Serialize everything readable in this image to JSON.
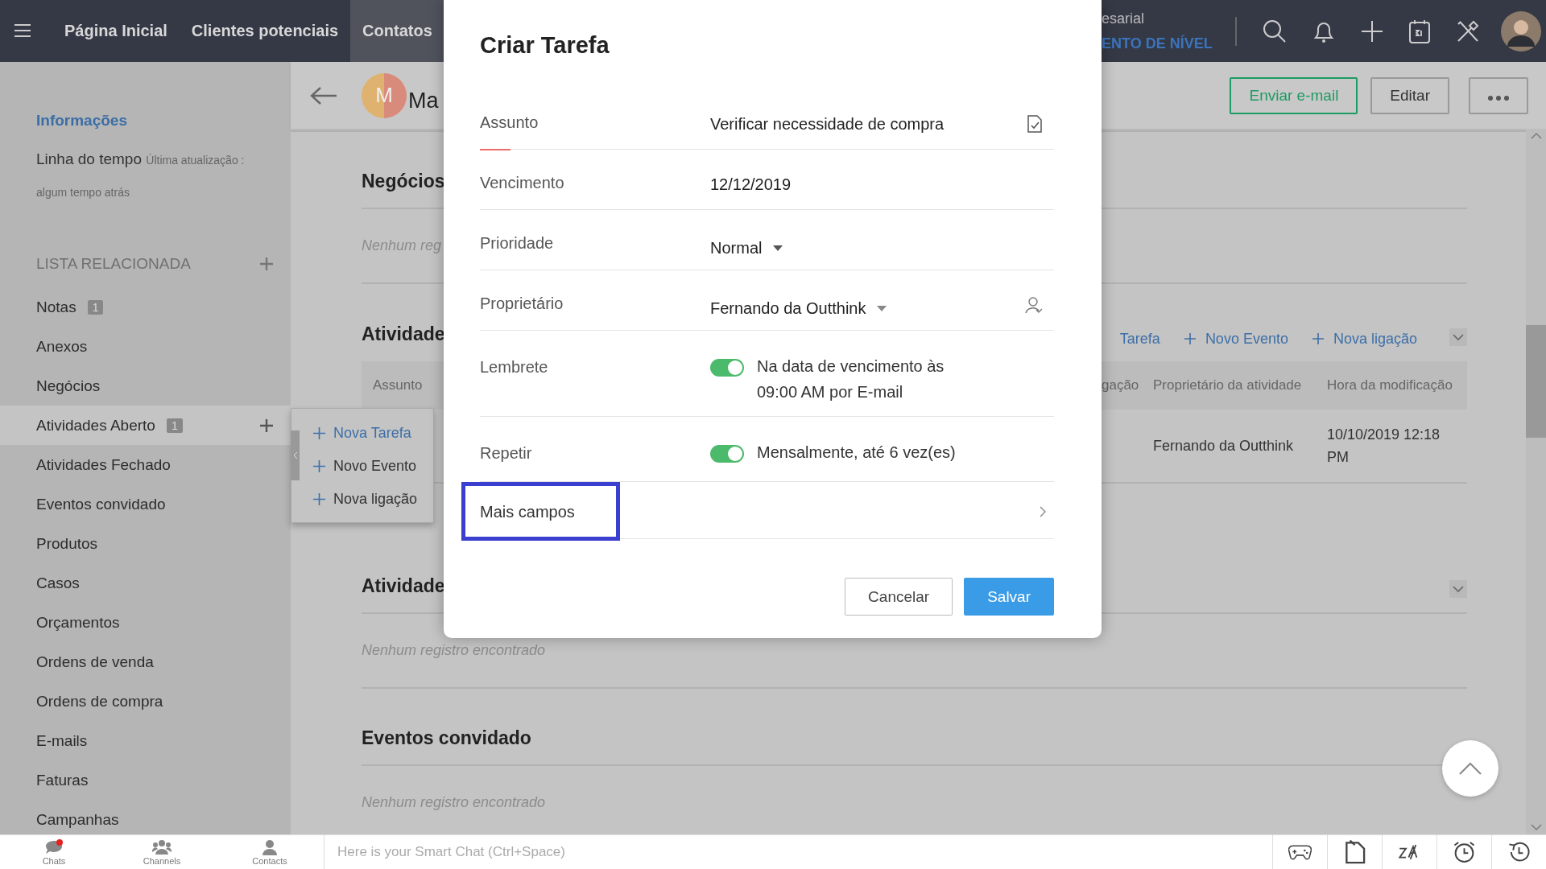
{
  "top_nav": {
    "items": [
      {
        "label": "Página Inicial",
        "selected": false
      },
      {
        "label": "Clientes potenciais",
        "selected": false
      },
      {
        "label": "Contatos",
        "selected": true
      }
    ],
    "edition_text": "esarial",
    "upgrade_link": "ENTO DE NÍVEL"
  },
  "sidebar": {
    "info_link": "Informações",
    "timeline_label": "Linha do tempo",
    "timeline_updated": "Última atualização :",
    "timeline_time": "algum tempo atrás",
    "related_heading": "LISTA RELACIONADA",
    "items": [
      {
        "label": "Notas",
        "badge": "1",
        "selected": false
      },
      {
        "label": "Anexos",
        "selected": false
      },
      {
        "label": "Negócios",
        "selected": false
      },
      {
        "label": "Atividades Aberto",
        "badge": "1",
        "selected": true
      },
      {
        "label": "Atividades Fechado",
        "selected": false
      },
      {
        "label": "Eventos convidado",
        "selected": false
      },
      {
        "label": "Produtos",
        "selected": false
      },
      {
        "label": "Casos",
        "selected": false
      },
      {
        "label": "Orçamentos",
        "selected": false
      },
      {
        "label": "Ordens de venda",
        "selected": false
      },
      {
        "label": "Ordens de compra",
        "selected": false
      },
      {
        "label": "E-mails",
        "selected": false
      },
      {
        "label": "Faturas",
        "selected": false
      },
      {
        "label": "Campanhas",
        "selected": false
      }
    ]
  },
  "popover": {
    "items": [
      {
        "label": "Nova Tarefa",
        "selected": true
      },
      {
        "label": "Novo Evento",
        "selected": false
      },
      {
        "label": "Nova ligação",
        "selected": false
      }
    ]
  },
  "record": {
    "avatar_letter": "M",
    "name": "Ma",
    "actions": [
      {
        "label": "Enviar e-mail",
        "kind": "primary"
      },
      {
        "label": "Editar",
        "kind": "default"
      }
    ]
  },
  "sections": [
    {
      "kind": "empty",
      "title": "Negócios",
      "empty_text": "Nenhum reg",
      "collapsible": false
    },
    {
      "kind": "table",
      "title": "Atividade",
      "collapsible": true,
      "links": [
        {
          "label": "Tarefa",
          "plus": false
        },
        {
          "label": "Novo Evento",
          "plus": true
        },
        {
          "label": "Nova ligação",
          "plus": true
        }
      ],
      "first_column": "Assunto",
      "columns": [
        "gação",
        "Proprietário da atividade",
        "Hora da modificação"
      ],
      "rows": [
        {
          "cells": [
            "",
            "Fernando da Outthink",
            "10/10/2019 12:18 PM"
          ]
        }
      ]
    },
    {
      "kind": "empty",
      "title": "Atividade",
      "empty_text": "Nenhum registro encontrado",
      "collapsible": true
    },
    {
      "kind": "empty",
      "title": "Eventos convidado",
      "empty_text": "Nenhum registro encontrado",
      "collapsible": false
    }
  ],
  "modal": {
    "title": "Criar Tarefa",
    "fields": [
      {
        "kind": "text",
        "label": "Assunto",
        "value": "Verificar necessidade de compra",
        "focused": true
      },
      {
        "kind": "date",
        "label": "Vencimento",
        "value": "12/12/2019",
        "focused": false
      },
      {
        "kind": "select",
        "label": "Prioridade",
        "value": "Normal",
        "focused": false
      },
      {
        "kind": "user",
        "label": "Proprietário",
        "value": "Fernando da Outthink",
        "focused": false
      },
      {
        "kind": "toggle",
        "label": "Lembrete",
        "on": true,
        "value": "Na data de vencimento às 09:00 AM por E-mail",
        "focused": false
      },
      {
        "kind": "toggle",
        "label": "Repetir",
        "on": true,
        "value": "Mensalmente, até 6 vez(es)",
        "focused": false
      },
      {
        "kind": "more",
        "label": "Mais campos",
        "highlighted": true
      }
    ],
    "buttons": [
      {
        "label": "Cancelar",
        "kind": "secondary"
      },
      {
        "label": "Salvar",
        "kind": "primary"
      }
    ]
  },
  "chat_bar": {
    "tabs": [
      {
        "label": "Chats",
        "unread": true
      },
      {
        "label": "Channels",
        "unread": false
      },
      {
        "label": "Contacts",
        "unread": false
      }
    ],
    "placeholder": "Here is your Smart Chat (Ctrl+Space)"
  }
}
